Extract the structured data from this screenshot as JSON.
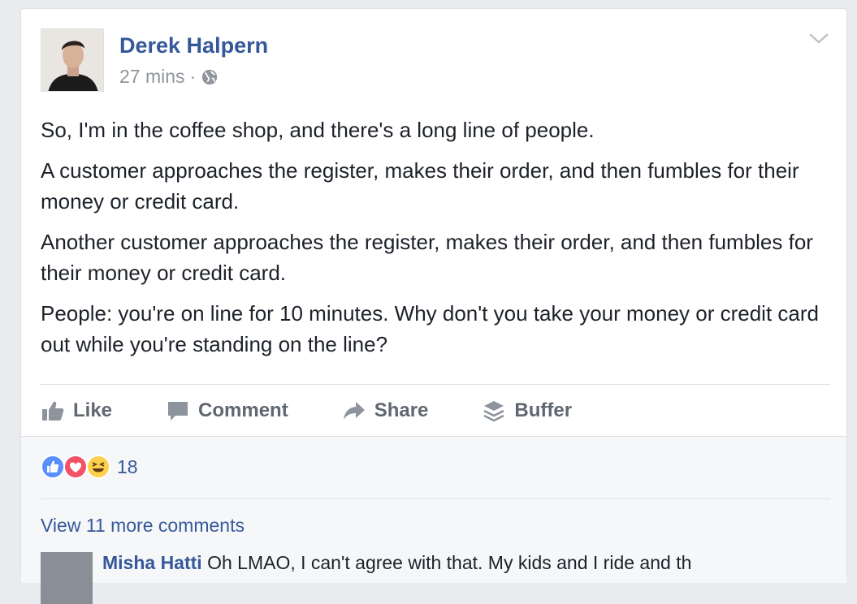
{
  "post": {
    "author": "Derek Halpern",
    "time": "27 mins",
    "separator": "·",
    "paragraphs": [
      "So, I'm in the coffee shop, and there's a long line of people.",
      "A customer approaches the register, makes their order, and then fumbles for their money or credit card.",
      "Another customer approaches the register, makes their order, and then fumbles for their money or credit card.",
      "People: you're on line for 10 minutes. Why don't you take your money or credit card out while you're standing on the line?"
    ]
  },
  "actions": {
    "like": "Like",
    "comment": "Comment",
    "share": "Share",
    "buffer": "Buffer"
  },
  "reactions": {
    "count": "18",
    "colors": {
      "like": "#5890ff",
      "love": "#f25268",
      "haha": "#fcd04a"
    }
  },
  "comments": {
    "view_more": "View 11 more comments",
    "next": {
      "name": "Misha Hatti",
      "text": "Oh LMAO, I can't agree with that. My kids and I ride and th"
    }
  },
  "icons": [
    "globe-icon",
    "chevron-down-icon",
    "like-icon",
    "comment-icon",
    "share-icon",
    "buffer-icon"
  ]
}
